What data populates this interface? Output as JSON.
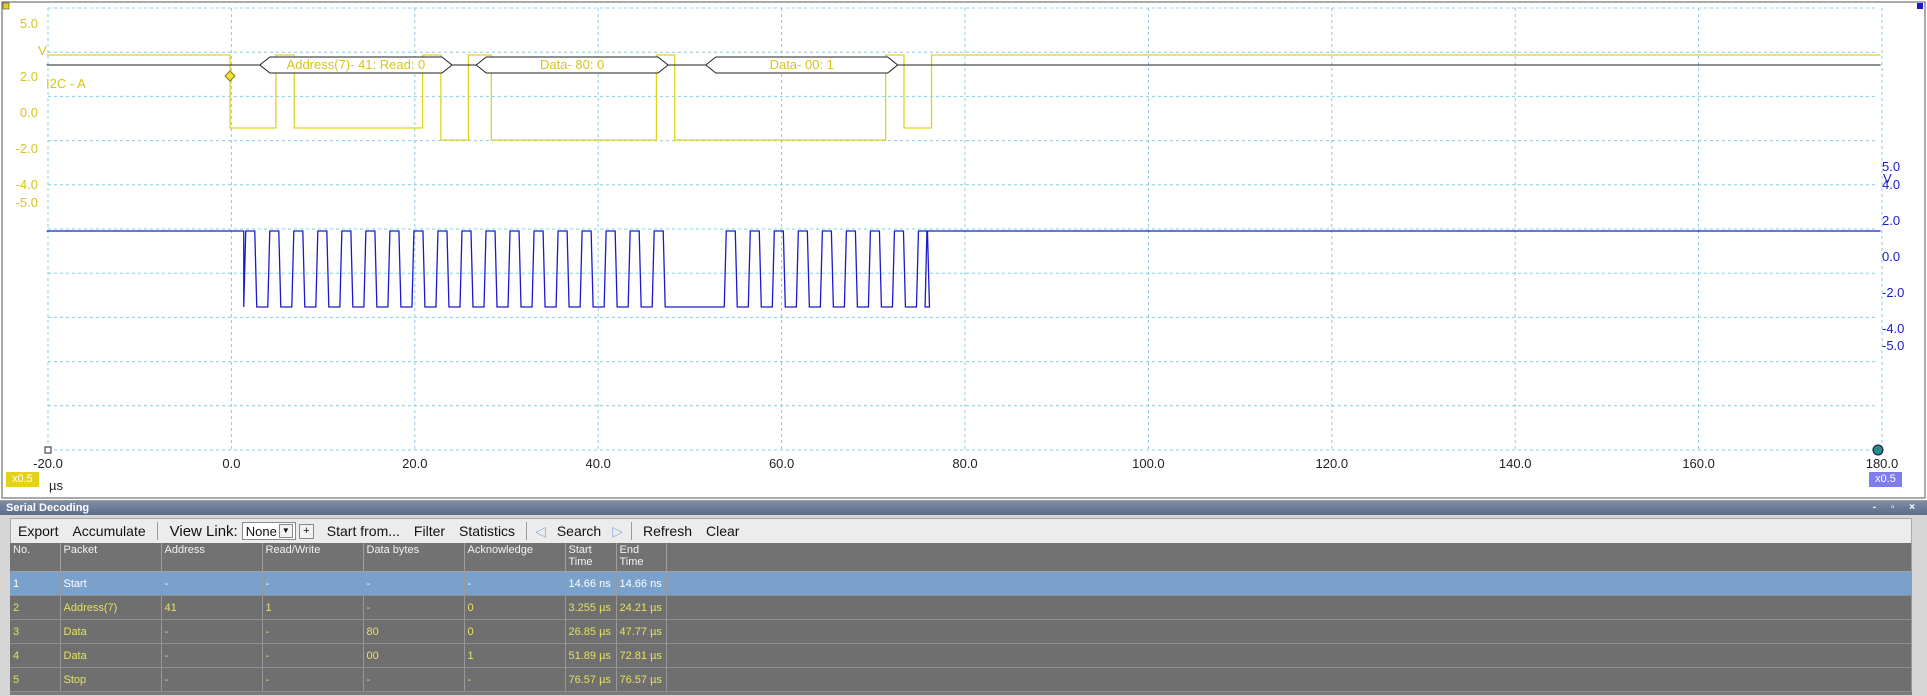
{
  "colors": {
    "channel_a": "#e3d21c",
    "channel_b": "#1a1acc",
    "grid": "#88ccdd",
    "selected_row": "#7aa0cc"
  },
  "scope": {
    "left_axis": {
      "unit": "V",
      "ticks": [
        "5.0",
        "2.0",
        "0.0",
        "-2.0",
        "-4.0",
        "-5.0"
      ]
    },
    "right_axis": {
      "unit": "V",
      "ticks": [
        "5.0",
        "4.0",
        "2.0",
        "0.0",
        "-2.0",
        "-4.0",
        "-5.0"
      ]
    },
    "x_axis": {
      "unit": "µs",
      "ticks": [
        "-20.0",
        "0.0",
        "20.0",
        "40.0",
        "60.0",
        "80.0",
        "100.0",
        "120.0",
        "140.0",
        "160.0",
        "180.0"
      ]
    },
    "scale_left": "x0.5",
    "scale_right": "x0.5",
    "decode_label": "I2C - A",
    "decode_packets": [
      {
        "label": "Address(7)- 41: Read: 0",
        "start": 3.255,
        "end": 24.21
      },
      {
        "label": "Data- 80: 0",
        "start": 26.85,
        "end": 47.77
      },
      {
        "label": "Data- 00: 1",
        "start": 51.89,
        "end": 72.81
      }
    ]
  },
  "decoding": {
    "title": "Serial Decoding",
    "window_controls": "- ▫ ×",
    "toolbar": {
      "export": "Export",
      "accumulate": "Accumulate",
      "view_link": "View Link:",
      "view_link_value": "None",
      "start_from": "Start from...",
      "filter": "Filter",
      "statistics": "Statistics",
      "search": "Search",
      "refresh": "Refresh",
      "clear": "Clear"
    },
    "columns": [
      "No.",
      "Packet",
      "Address",
      "Read/Write",
      "Data bytes",
      "Acknowledge",
      "Start\nTime",
      "End Time"
    ],
    "rows": [
      [
        "1",
        "Start",
        "-",
        "-",
        "-",
        "-",
        "14.66 ns",
        "14.66 ns"
      ],
      [
        "2",
        "Address(7)",
        "41",
        "1",
        "-",
        "0",
        "3.255 µs",
        "24.21 µs"
      ],
      [
        "3",
        "Data",
        "-",
        "-",
        "80",
        "0",
        "26.85 µs",
        "47.77 µs"
      ],
      [
        "4",
        "Data",
        "-",
        "-",
        "00",
        "1",
        "51.89 µs",
        "72.81 µs"
      ],
      [
        "5",
        "Stop",
        "-",
        "-",
        "-",
        "-",
        "76.57 µs",
        "76.57 µs"
      ]
    ]
  }
}
